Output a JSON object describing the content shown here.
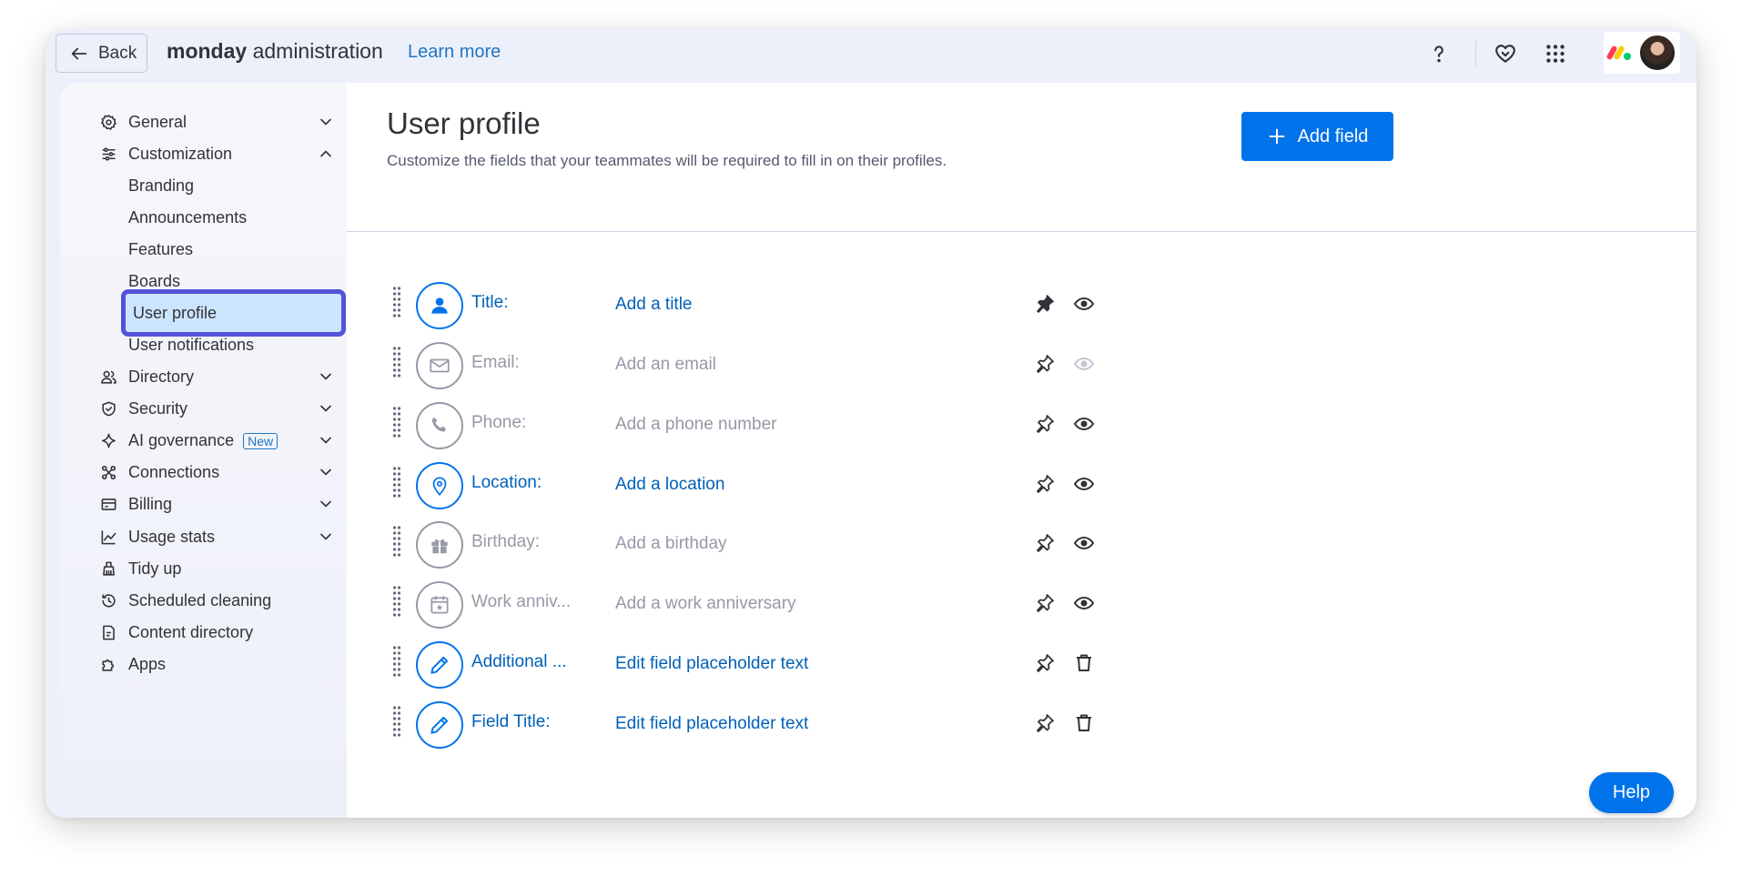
{
  "topbar": {
    "back_label": "Back",
    "brand_bold": "monday",
    "brand_rest": "administration",
    "learn_more": "Learn more",
    "icons": [
      "help-icon",
      "heart-icon",
      "apps-grid-icon"
    ]
  },
  "sidebar": {
    "items": [
      {
        "label": "General",
        "icon": "gear-icon",
        "chevron": "down"
      },
      {
        "label": "Customization",
        "icon": "sliders-icon",
        "chevron": "up"
      },
      {
        "label": "Directory",
        "icon": "people-icon",
        "chevron": "down"
      },
      {
        "label": "Security",
        "icon": "shield-icon",
        "chevron": "down"
      },
      {
        "label": "AI governance",
        "badge": "New",
        "icon": "sparkle-icon",
        "chevron": "down"
      },
      {
        "label": "Connections",
        "icon": "connections-icon",
        "chevron": "down"
      },
      {
        "label": "Billing",
        "icon": "credit-card-icon",
        "chevron": "down"
      },
      {
        "label": "Usage stats",
        "icon": "chart-icon",
        "chevron": "down"
      },
      {
        "label": "Tidy up",
        "icon": "broom-icon"
      },
      {
        "label": "Scheduled cleaning",
        "icon": "clock-icon"
      },
      {
        "label": "Content directory",
        "icon": "document-icon"
      },
      {
        "label": "Apps",
        "icon": "puzzle-icon"
      }
    ],
    "sub_items": [
      "Branding",
      "Announcements",
      "Features",
      "Boards",
      "User profile",
      "User notifications"
    ],
    "active": "User profile"
  },
  "main": {
    "title": "User profile",
    "subtitle": "Customize the fields that your teammates will be required to fill in on their profiles.",
    "add_field_label": "Add field",
    "fields": [
      {
        "label": "Title:",
        "placeholder": "Add a title",
        "icon": "person-icon",
        "enabled": true,
        "pinned": true,
        "action": "visibility"
      },
      {
        "label": "Email:",
        "placeholder": "Add an email",
        "icon": "envelope-icon",
        "enabled": false,
        "pinned": false,
        "action": "visibility"
      },
      {
        "label": "Phone:",
        "placeholder": "Add a phone number",
        "icon": "phone-icon",
        "enabled": false,
        "pinned": false,
        "action": "visibility"
      },
      {
        "label": "Location:",
        "placeholder": "Add a location",
        "icon": "location-pin-icon",
        "enabled": true,
        "pinned": false,
        "action": "visibility"
      },
      {
        "label": "Birthday:",
        "placeholder": "Add a birthday",
        "icon": "gift-icon",
        "enabled": false,
        "pinned": false,
        "action": "visibility"
      },
      {
        "label": "Work anniv...",
        "placeholder": "Add a work anniversary",
        "icon": "calendar-icon",
        "enabled": false,
        "pinned": false,
        "action": "visibility"
      },
      {
        "label": "Additional ...",
        "placeholder": "Edit field placeholder text",
        "icon": "pencil-icon",
        "enabled": true,
        "pinned": false,
        "action": "delete"
      },
      {
        "label": "Field Title:",
        "placeholder": "Edit field placeholder text",
        "icon": "pencil-icon",
        "enabled": true,
        "pinned": false,
        "action": "delete"
      }
    ]
  },
  "help_label": "Help",
  "colors": {
    "primary": "#0073ea",
    "link": "#0060b9",
    "muted": "#9699a6",
    "active_border": "#5452d8",
    "active_bg": "#cce5ff"
  }
}
